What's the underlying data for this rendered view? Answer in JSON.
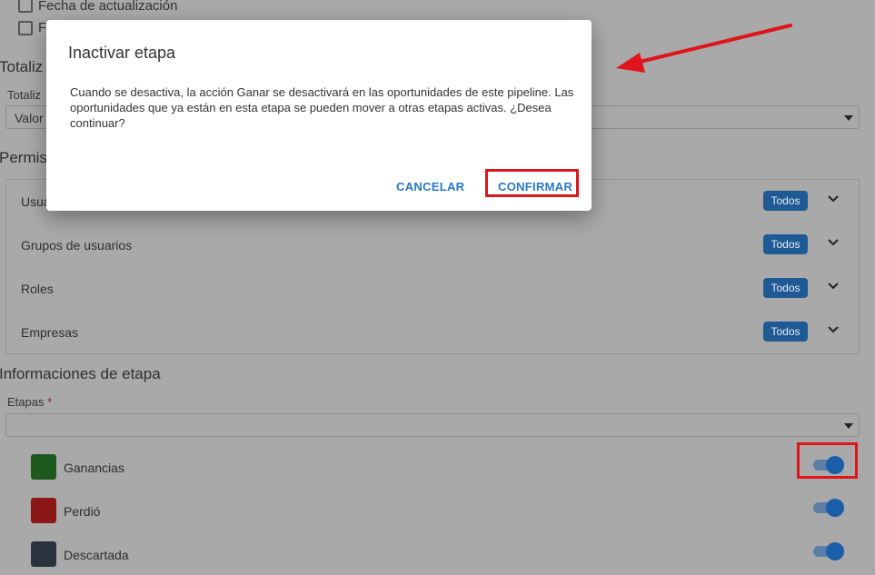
{
  "filters": {
    "checkboxes": [
      {
        "label": "Fecha de actualización",
        "checked": false
      },
      {
        "label": "F",
        "checked": false
      }
    ]
  },
  "totalization": {
    "section_title": "Totaliz",
    "field_label": "Totaliz",
    "select_value": "Valor"
  },
  "permissions": {
    "section_title": "Permis",
    "rows": [
      {
        "label": "Usua",
        "badge": "Todos"
      },
      {
        "label": "Grupos de usuarios",
        "badge": "Todos"
      },
      {
        "label": "Roles",
        "badge": "Todos"
      },
      {
        "label": "Empresas",
        "badge": "Todos"
      }
    ]
  },
  "stage_info": {
    "section_title": "Informaciones de etapa",
    "stages_label": "Etapas",
    "required_marker": "*",
    "stages_value": "",
    "stages": [
      {
        "label": "Ganancias",
        "color": "#1e5a1e",
        "active": true
      },
      {
        "label": "Perdió",
        "color": "#8b1717",
        "active": true
      },
      {
        "label": "Descartada",
        "color": "#28333d",
        "active": true
      }
    ]
  },
  "dialog": {
    "title": "Inactivar etapa",
    "message": "Cuando se desactiva, la acción Ganar se desactivará en las oportunidades de este pipeline. Las oportunidades que ya están en esta etapa se pueden mover a otras etapas activas. ¿Desea continuar?",
    "cancel_label": "CANCELAR",
    "confirm_label": "CONFIRMAR"
  },
  "colors": {
    "overlay_background": "#a9a9a9",
    "badge": "#1f5a95",
    "toggle_on": "#1a5da8",
    "dialog_button": "#2a78c6",
    "annotation_red": "#e0141b"
  }
}
